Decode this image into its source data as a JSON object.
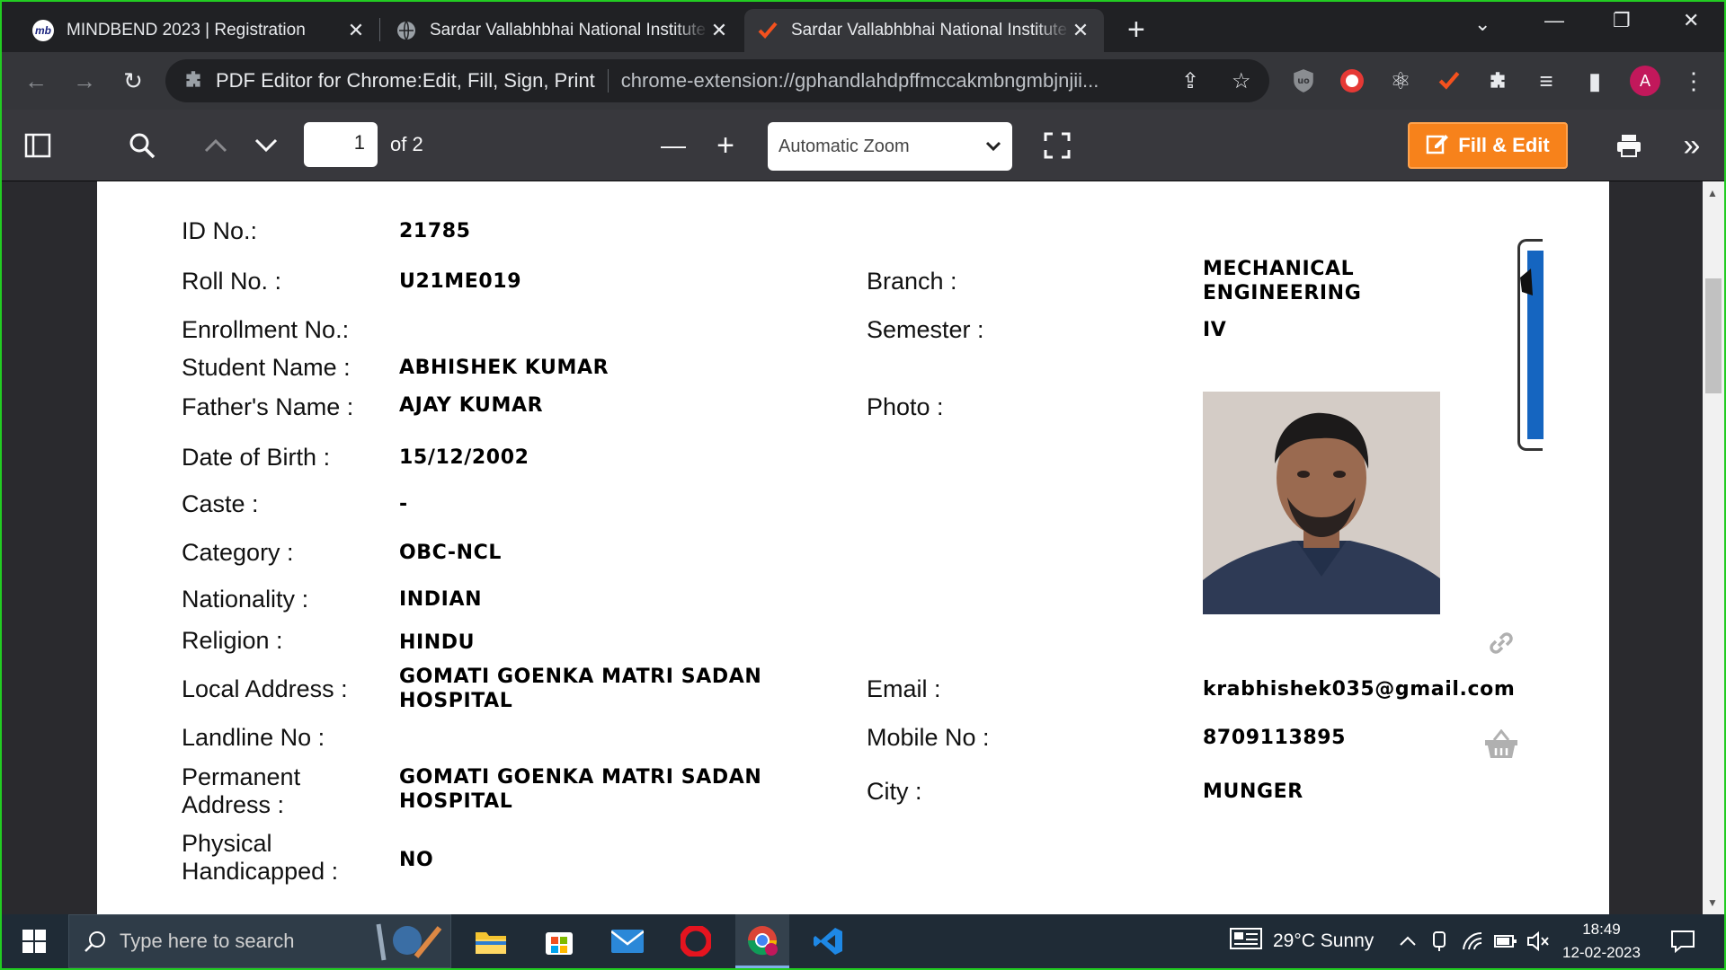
{
  "browser": {
    "tabs": [
      {
        "title": "MINDBEND 2023 | Registration",
        "close": "✕"
      },
      {
        "title": "Sardar Vallabhbhai National Institute",
        "close": "✕"
      },
      {
        "title": "Sardar Vallabhbhai National Institute",
        "close": "✕"
      }
    ],
    "new_tab": "+",
    "omnibox": {
      "extension_name": "PDF Editor for Chrome:Edit, Fill, Sign, Print",
      "url": "chrome-extension://gphandlahdpffmccakmbngmbjnjii..."
    },
    "profile_initial": "A"
  },
  "pdf_toolbar": {
    "page_number": "1",
    "page_count": "of 2",
    "zoom": "Automatic Zoom",
    "fill_edit_label": "Fill & Edit"
  },
  "document": {
    "left_fields": [
      {
        "label": "ID No.:",
        "value": "21785"
      },
      {
        "label": "Roll No. :",
        "value": "U21ME019"
      },
      {
        "label": "Enrollment No.:",
        "value": ""
      },
      {
        "label": "Student Name :",
        "value": "ABHISHEK KUMAR"
      },
      {
        "label": "Father's Name :",
        "value": "AJAY KUMAR"
      },
      {
        "label": "Date of Birth :",
        "value": "15/12/2002"
      },
      {
        "label": "Caste :",
        "value": "-"
      },
      {
        "label": "Category :",
        "value": "OBC-NCL"
      },
      {
        "label": "Nationality :",
        "value": "INDIAN"
      },
      {
        "label": "Religion :",
        "value": "HINDU"
      },
      {
        "label": "Local Address :",
        "value": "GOMATI GOENKA MATRI SADAN HOSPITAL"
      },
      {
        "label": "Landline No :",
        "value": ""
      },
      {
        "label": "Permanent Address :",
        "value": "GOMATI GOENKA MATRI SADAN HOSPITAL"
      },
      {
        "label": "Physical Handicapped :",
        "value": "NO"
      }
    ],
    "right_fields": [
      {
        "label": "Branch :",
        "value": "MECHANICAL ENGINEERING"
      },
      {
        "label": "Semester :",
        "value": "IV"
      },
      {
        "label": "Photo :",
        "value": ""
      },
      {
        "label": "Email :",
        "value": "krabhishek035@gmail.com"
      },
      {
        "label": "Mobile No :",
        "value": "8709113895"
      },
      {
        "label": "City :",
        "value": "MUNGER"
      }
    ]
  },
  "taskbar": {
    "search_placeholder": "Type here to search",
    "weather": "29°C  Sunny",
    "time": "18:49",
    "date": "12-02-2023"
  },
  "colors": {
    "fill_edit": "#f7821b",
    "window_border": "#22cc22",
    "avatar": "#c2185b"
  }
}
